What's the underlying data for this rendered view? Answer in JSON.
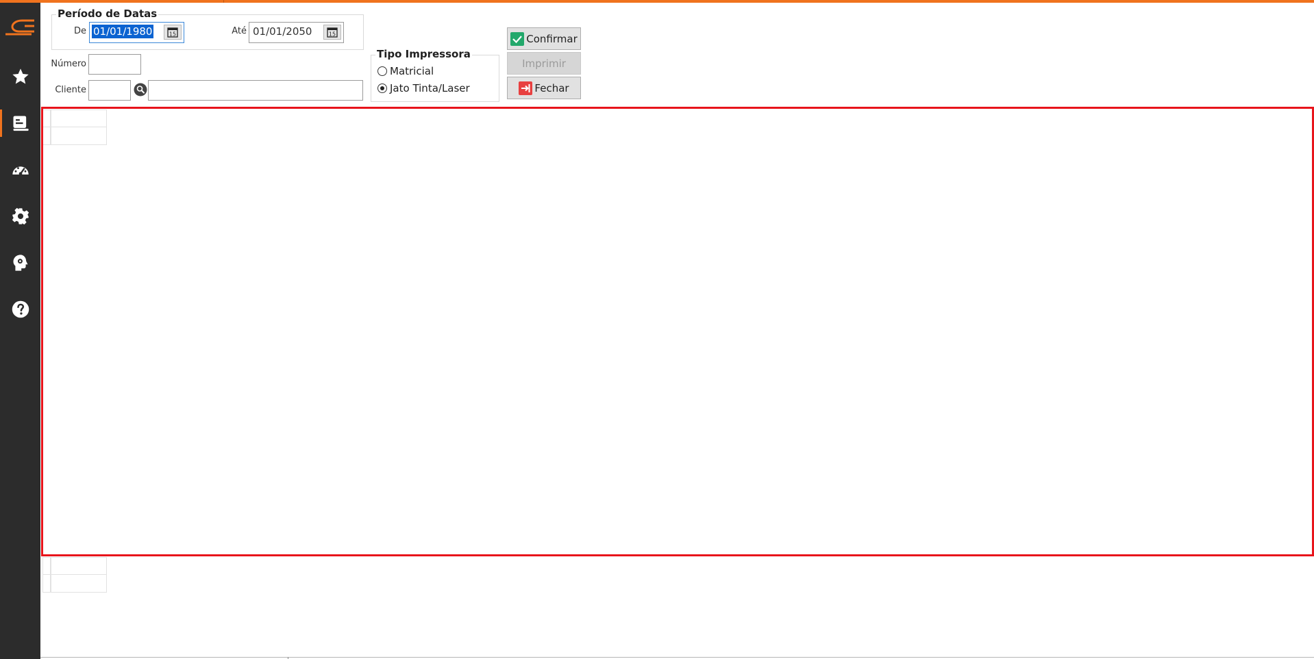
{
  "sidebar": {
    "items": [
      {
        "name": "favorites",
        "icon": "star-icon"
      },
      {
        "name": "reports",
        "icon": "report-icon",
        "active": true
      },
      {
        "name": "dashboard",
        "icon": "speedometer-icon"
      },
      {
        "name": "settings",
        "icon": "gear-icon"
      },
      {
        "name": "brain",
        "icon": "brain-gear-icon"
      },
      {
        "name": "help",
        "icon": "help-icon"
      }
    ],
    "accent": "#f0731e",
    "background": "#2c2c2c"
  },
  "periodo": {
    "title": "Período de Datas",
    "de_label": "De",
    "de_value": "01/01/1980",
    "ate_label": "Até",
    "ate_value": "01/01/2050"
  },
  "filters": {
    "numero_label": "Número",
    "numero_value": "",
    "cliente_label": "Cliente",
    "cliente_code": "",
    "cliente_name": ""
  },
  "impressora": {
    "title": "Tipo Impressora",
    "options": [
      "Matricial",
      "Jato Tinta/Laser"
    ],
    "selected": "Jato Tinta/Laser"
  },
  "buttons": {
    "confirmar": "Confirmar",
    "imprimir": "Imprimir",
    "fechar": "Fechar"
  },
  "colors": {
    "highlight": "#e8141b",
    "selection": "#0b63d1",
    "confirm_icon": "#22a86b",
    "close_icon": "#e84040"
  }
}
